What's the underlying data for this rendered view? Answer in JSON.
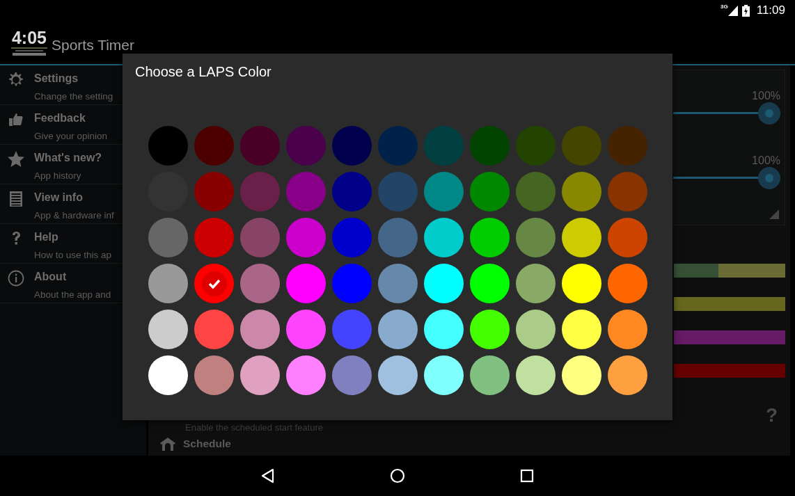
{
  "status_bar": {
    "network": "3G",
    "time": "11:09"
  },
  "action_bar": {
    "logo": "4:05",
    "title": "Sports Timer"
  },
  "drawer": {
    "items": [
      {
        "title": "Settings",
        "subtitle": "Change the setting"
      },
      {
        "title": "Feedback",
        "subtitle": "Give your opinion"
      },
      {
        "title": "What's new?",
        "subtitle": "App history"
      },
      {
        "title": "View info",
        "subtitle": "App & hardware inf"
      },
      {
        "title": "Help",
        "subtitle": "How to use this ap"
      },
      {
        "title": "About",
        "subtitle": "About the app and"
      }
    ]
  },
  "content": {
    "sliders": [
      {
        "reading": "100%",
        "level": 1
      },
      {
        "reading": "100%",
        "level": 1
      }
    ],
    "lap_bars": [
      {
        "segments": [
          {
            "color": "#355035",
            "level": 0.4
          },
          {
            "color": "#6b6b36",
            "level": 0.6
          }
        ]
      },
      {
        "segments": [
          {
            "color": "#66661e",
            "level": 1
          }
        ]
      },
      {
        "segments": [
          {
            "color": "#651b65",
            "level": 1
          }
        ]
      },
      {
        "segments": [
          {
            "color": "#660000",
            "level": 1
          }
        ]
      }
    ],
    "help": "?",
    "schedule_hint": "Enable the scheduled start feature",
    "schedule_title": "Schedule"
  },
  "dialog": {
    "title": "Choose a LAPS Color",
    "rows": [
      {
        "swatches": [
          {
            "color": "#000000",
            "selected": false
          },
          {
            "color": "#4d0000",
            "selected": false
          },
          {
            "color": "#4a0026",
            "selected": false
          },
          {
            "color": "#4a004a",
            "selected": false
          },
          {
            "color": "#00004d",
            "selected": false
          },
          {
            "color": "#00224a",
            "selected": false
          },
          {
            "color": "#004040",
            "selected": false
          },
          {
            "color": "#004400",
            "selected": false
          },
          {
            "color": "#224400",
            "selected": false
          },
          {
            "color": "#454500",
            "selected": false
          },
          {
            "color": "#452200",
            "selected": false
          }
        ]
      },
      {
        "swatches": [
          {
            "color": "#333333",
            "selected": false
          },
          {
            "color": "#880000",
            "selected": false
          },
          {
            "color": "#6b2049",
            "selected": false
          },
          {
            "color": "#880088",
            "selected": false
          },
          {
            "color": "#000088",
            "selected": false
          },
          {
            "color": "#224466",
            "selected": false
          },
          {
            "color": "#008888",
            "selected": false
          },
          {
            "color": "#008800",
            "selected": false
          },
          {
            "color": "#446622",
            "selected": false
          },
          {
            "color": "#888800",
            "selected": false
          },
          {
            "color": "#883300",
            "selected": false
          }
        ]
      },
      {
        "swatches": [
          {
            "color": "#666666",
            "selected": false
          },
          {
            "color": "#cc0000",
            "selected": false
          },
          {
            "color": "#884466",
            "selected": false
          },
          {
            "color": "#cc00cc",
            "selected": false
          },
          {
            "color": "#0000cc",
            "selected": false
          },
          {
            "color": "#446688",
            "selected": false
          },
          {
            "color": "#00cccc",
            "selected": false
          },
          {
            "color": "#00cc00",
            "selected": false
          },
          {
            "color": "#668844",
            "selected": false
          },
          {
            "color": "#cccc00",
            "selected": false
          },
          {
            "color": "#cc4400",
            "selected": false
          }
        ]
      },
      {
        "swatches": [
          {
            "color": "#999999",
            "selected": false
          },
          {
            "color": "#ff0000",
            "selected": true
          },
          {
            "color": "#aa6688",
            "selected": false
          },
          {
            "color": "#ff00ff",
            "selected": false
          },
          {
            "color": "#0000ff",
            "selected": false
          },
          {
            "color": "#6688aa",
            "selected": false
          },
          {
            "color": "#00ffff",
            "selected": false
          },
          {
            "color": "#00ff00",
            "selected": false
          },
          {
            "color": "#88aa66",
            "selected": false
          },
          {
            "color": "#ffff00",
            "selected": false
          },
          {
            "color": "#ff6600",
            "selected": false
          }
        ]
      },
      {
        "swatches": [
          {
            "color": "#cccccc",
            "selected": false
          },
          {
            "color": "#ff4444",
            "selected": false
          },
          {
            "color": "#cc88aa",
            "selected": false
          },
          {
            "color": "#ff44ff",
            "selected": false
          },
          {
            "color": "#4444ff",
            "selected": false
          },
          {
            "color": "#88aacc",
            "selected": false
          },
          {
            "color": "#44ffff",
            "selected": false
          },
          {
            "color": "#44ff00",
            "selected": false
          },
          {
            "color": "#aacc88",
            "selected": false
          },
          {
            "color": "#ffff44",
            "selected": false
          },
          {
            "color": "#ff8822",
            "selected": false
          }
        ]
      },
      {
        "swatches": [
          {
            "color": "#ffffff",
            "selected": false
          },
          {
            "color": "#c08080",
            "selected": false
          },
          {
            "color": "#e0a0c0",
            "selected": false
          },
          {
            "color": "#ff80ff",
            "selected": false
          },
          {
            "color": "#8080c0",
            "selected": false
          },
          {
            "color": "#a0c0e0",
            "selected": false
          },
          {
            "color": "#80ffff",
            "selected": false
          },
          {
            "color": "#80c080",
            "selected": false
          },
          {
            "color": "#c0e0a0",
            "selected": false
          },
          {
            "color": "#ffff80",
            "selected": false
          },
          {
            "color": "#ffa040",
            "selected": false
          }
        ]
      }
    ]
  }
}
